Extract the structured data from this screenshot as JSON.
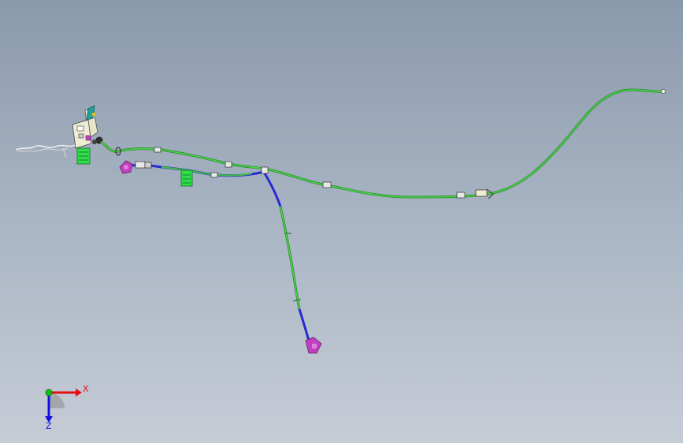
{
  "viewport": {
    "background_top": "#8a99ac",
    "background_bottom": "#c6ccd6"
  },
  "colors": {
    "harness_green": "#3fbf3f",
    "harness_green_dark": "#1f8a1f",
    "harness_blue": "#2a2ad0",
    "connector_magenta": "#c040c0",
    "connector_green": "#2fdc4a",
    "bracket_teal": "#20a0a0",
    "axis_x": "#e01010",
    "axis_y": "#10c010",
    "axis_z": "#1010e0"
  },
  "triad": {
    "x_label": "X",
    "z_label": "Z"
  },
  "icons": {
    "triad": "coordinate-triad-icon"
  }
}
